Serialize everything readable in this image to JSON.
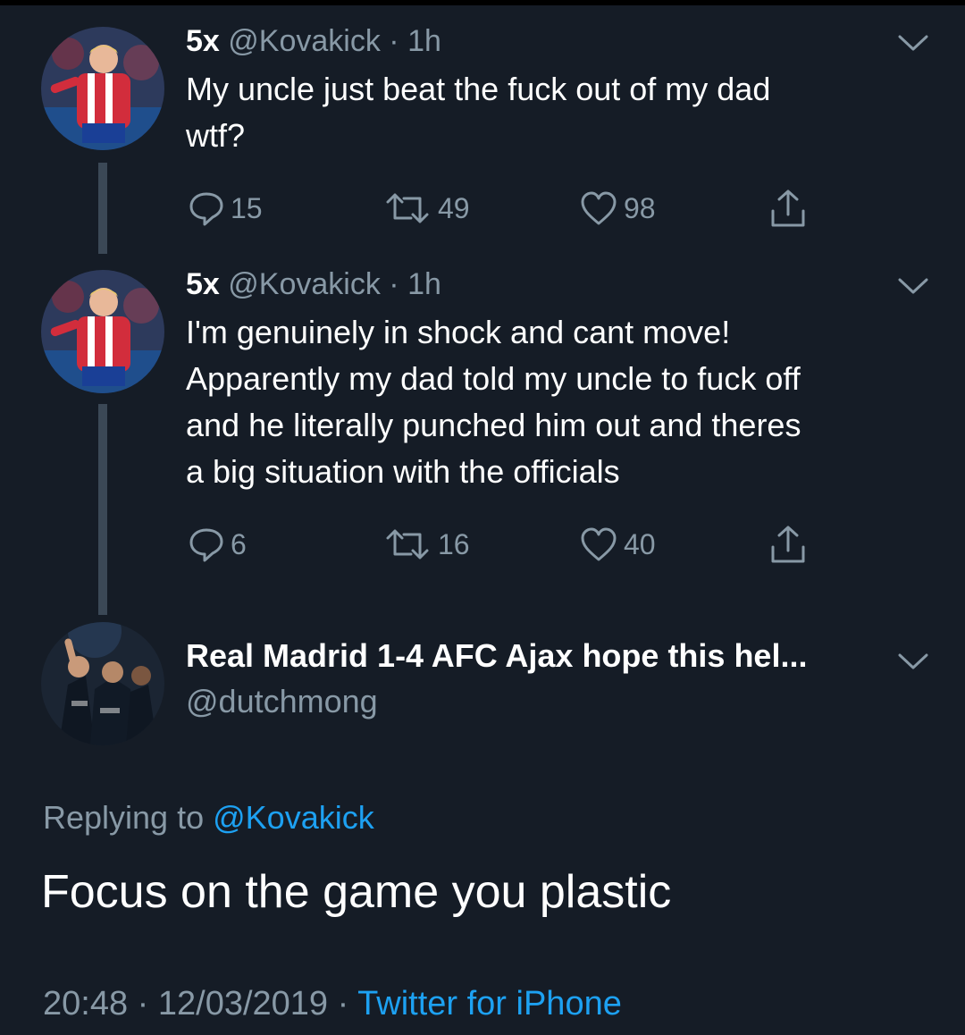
{
  "tweets": [
    {
      "name": "5x",
      "handle": "@Kovakick",
      "time": "1h",
      "text_lines": [
        "My uncle just beat the fuck out of my dad",
        "wtf?"
      ],
      "replies": "15",
      "retweets": "49",
      "likes": "98"
    },
    {
      "name": "5x",
      "handle": "@Kovakick",
      "time": "1h",
      "text_lines": [
        "I'm genuinely in shock and cant move!",
        "Apparently my dad told my uncle to fuck off",
        "and he literally punched him out and theres",
        "a big situation with the officials"
      ],
      "replies": "6",
      "retweets": "16",
      "likes": "40"
    }
  ],
  "reply": {
    "name": "Real Madrid 1-4 AFC Ajax hope this hel...",
    "handle": "@dutchmong",
    "replying_prefix": "Replying to",
    "replying_to": "@Kovakick",
    "text": "Focus on the game you plastic",
    "time": "20:48",
    "date": "12/03/2019",
    "source": "Twitter for iPhone"
  },
  "icons": {
    "reply": "reply-icon",
    "retweet": "retweet-icon",
    "like": "heart-icon",
    "share": "share-icon",
    "menu": "chevron-down-icon"
  },
  "colors": {
    "background": "#151c26",
    "muted": "#8899a6",
    "link": "#1da1f2",
    "thread_line": "#3b4856"
  }
}
